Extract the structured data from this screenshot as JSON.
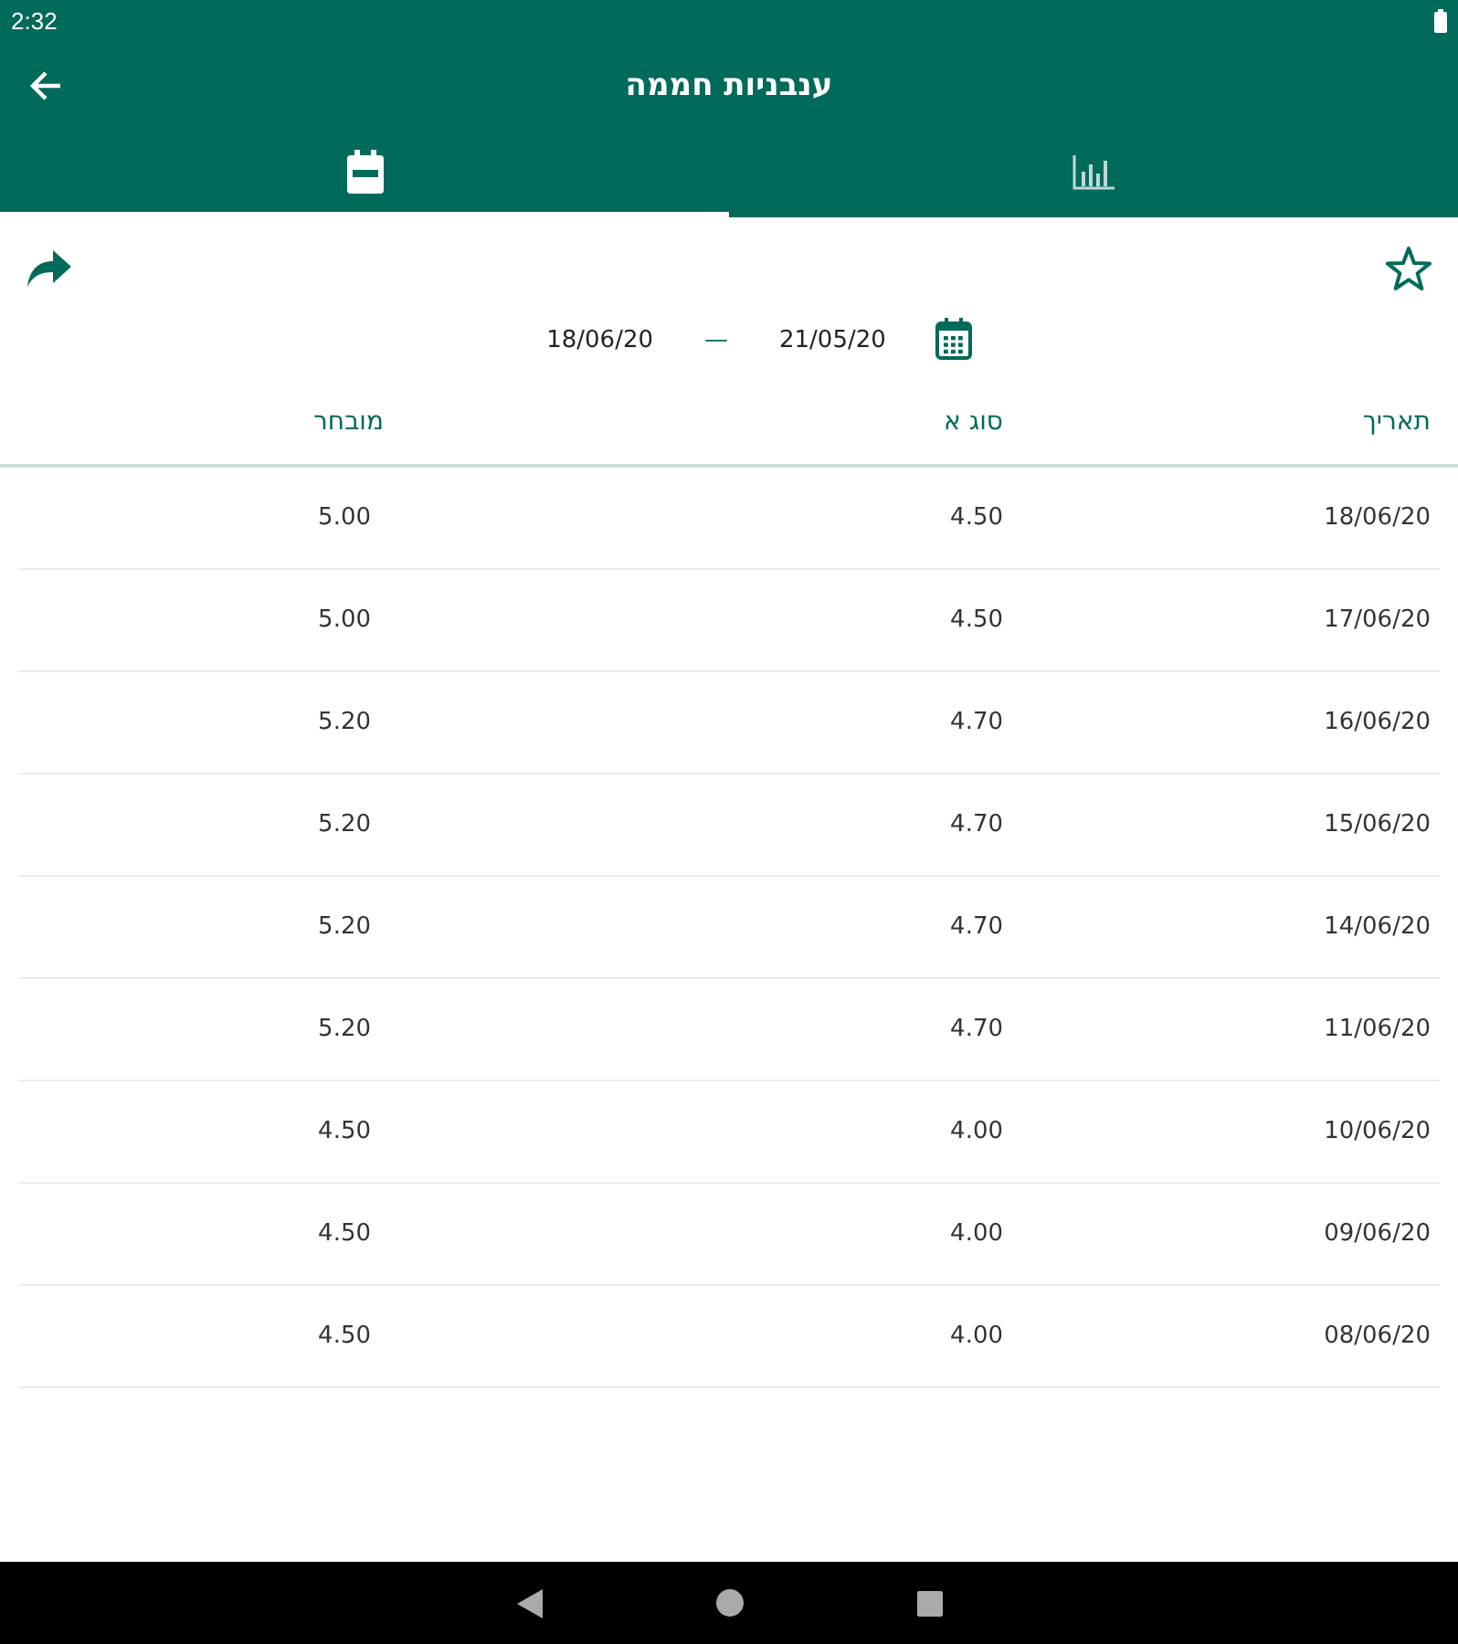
{
  "status_bar": {
    "time": "2:32"
  },
  "toolbar": {
    "title": "ענבניות חממה"
  },
  "tabs": [
    {
      "kind": "calendar",
      "selected": true
    },
    {
      "kind": "chart",
      "selected": false
    }
  ],
  "favorite": {
    "selected": false
  },
  "date_range": {
    "from": "21/05/20",
    "separator": "—",
    "to": "18/06/20"
  },
  "table": {
    "columns": [
      "מובחר",
      "סוג א",
      "תאריך"
    ],
    "rows": [
      [
        "5.00",
        "4.50",
        "18/06/20"
      ],
      [
        "5.00",
        "4.50",
        "17/06/20"
      ],
      [
        "5.20",
        "4.70",
        "16/06/20"
      ],
      [
        "5.20",
        "4.70",
        "15/06/20"
      ],
      [
        "5.20",
        "4.70",
        "14/06/20"
      ],
      [
        "5.20",
        "4.70",
        "11/06/20"
      ],
      [
        "4.50",
        "4.00",
        "10/06/20"
      ],
      [
        "4.50",
        "4.00",
        "09/06/20"
      ],
      [
        "4.50",
        "4.00",
        "08/06/20"
      ]
    ]
  }
}
